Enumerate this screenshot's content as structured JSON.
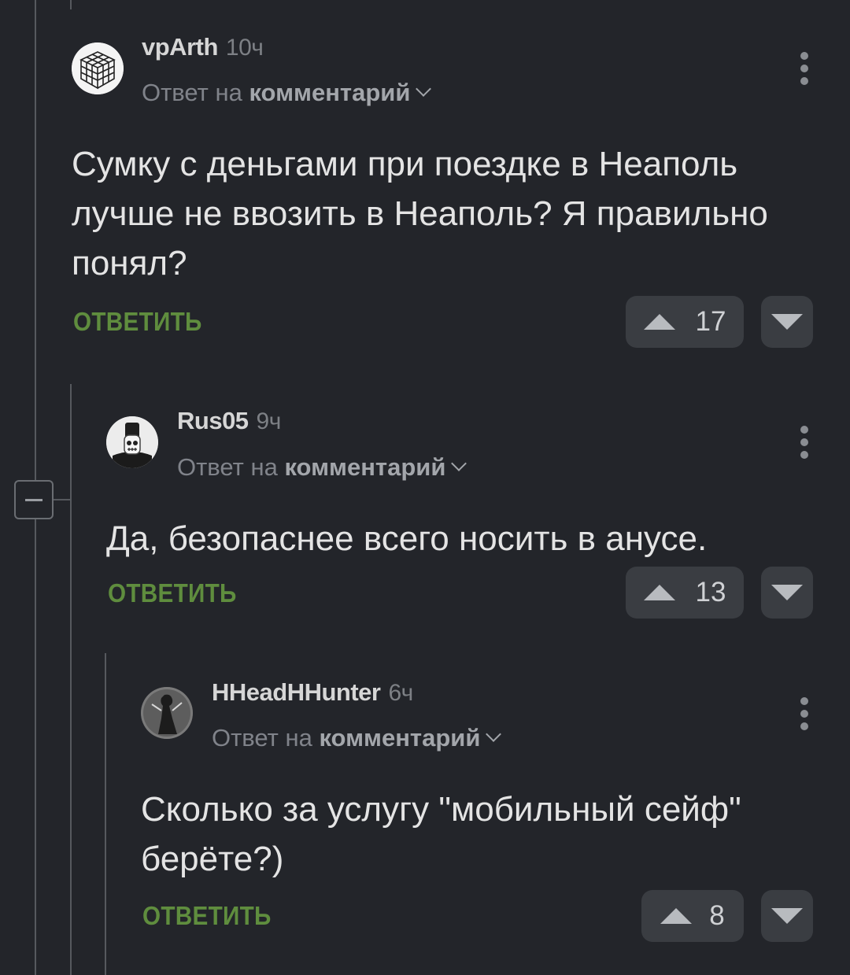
{
  "comments": [
    {
      "username": "vpArth",
      "time": "10ч",
      "reply_prefix": "Ответ на",
      "reply_target": "комментарий",
      "text": "Сумку с деньгами при поездке в Неаполь лучше не ввозить в Неаполь? Я правильно понял?",
      "reply_label": "ОТВЕТИТЬ",
      "rating": "17",
      "avatar_icon": "rubiks-cube-avatar"
    },
    {
      "username": "Rus05",
      "time": "9ч",
      "reply_prefix": "Ответ на",
      "reply_target": "комментарий",
      "text": "Да, безопаснее всего носить в анусе.",
      "reply_label": "ОТВЕТИТЬ",
      "rating": "13",
      "avatar_icon": "skeleton-character-avatar"
    },
    {
      "username": "HHeadHHunter",
      "time": "6ч",
      "reply_prefix": "Ответ на",
      "reply_target": "комментарий",
      "text": "Сколько за услугу \"мобильный сейф\" берёте?)",
      "reply_label": "ОТВЕТИТЬ",
      "rating": "8",
      "avatar_icon": "dark-figure-avatar"
    }
  ],
  "colors": {
    "background": "#23252a",
    "reply_green": "#5f8d3e",
    "vote_bg": "#3a3d42",
    "thread_line": "#56595e"
  }
}
